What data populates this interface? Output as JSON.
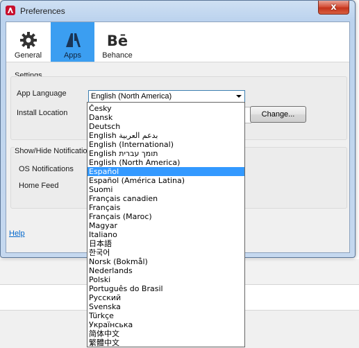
{
  "window": {
    "title": "Preferences",
    "close_glyph": "x"
  },
  "toolbar": {
    "items": [
      {
        "label": "General",
        "icon": "gear-icon"
      },
      {
        "label": "Apps",
        "icon": "adobe-apps-icon",
        "selected": true
      },
      {
        "label": "Behance",
        "icon": "behance-icon",
        "icon_text": "Bē"
      }
    ]
  },
  "settings": {
    "section_title": "Settings",
    "app_language_label": "App Language",
    "app_language_value": "English (North America)",
    "install_location_label": "Install Location",
    "change_button": "Change..."
  },
  "notifications": {
    "section_title": "Show/Hide Notificatio",
    "os_notifications_label": "OS Notifications",
    "home_feed_label": "Home Feed"
  },
  "help_link": "Help",
  "language_list": [
    "Česky",
    "Dansk",
    "Deutsch",
    "English بدعم العربية",
    "English (International)",
    "English תומך עברית",
    "English (North America)",
    "Español",
    "Español (América Latina)",
    "Suomi",
    "Français canadien",
    "Français",
    "Français (Maroc)",
    "Magyar",
    "Italiano",
    "日本語",
    "한국어",
    "Norsk (Bokmål)",
    "Nederlands",
    "Polski",
    "Português do Brasil",
    "Русский",
    "Svenska",
    "Türkçe",
    "Українська",
    "简体中文",
    "繁體中文"
  ],
  "highlighted_language": "Español",
  "colors": {
    "accent_selected_tab": "#3b9ef1",
    "list_highlight": "#3399ff",
    "close_button": "#c4341c",
    "link": "#0066cc"
  }
}
